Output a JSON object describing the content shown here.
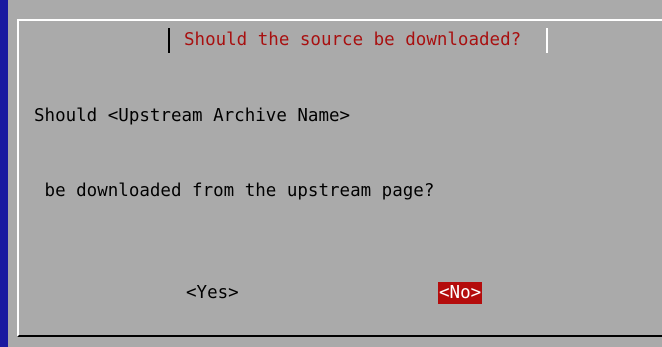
{
  "dialog": {
    "title": "Should the source be downloaded?",
    "message_lines": [
      "Should <Upstream Archive Name>",
      " be downloaded from the upstream page?"
    ],
    "buttons": {
      "yes_label": "<Yes>",
      "no_label": "<No>",
      "selected": "no"
    }
  },
  "colors": {
    "background": "#aaaaaa",
    "title_text": "#a81010",
    "selected_button_bg": "#b40c0c",
    "selected_button_text": "#ffffff",
    "left_edge": "#1a1aa0"
  }
}
